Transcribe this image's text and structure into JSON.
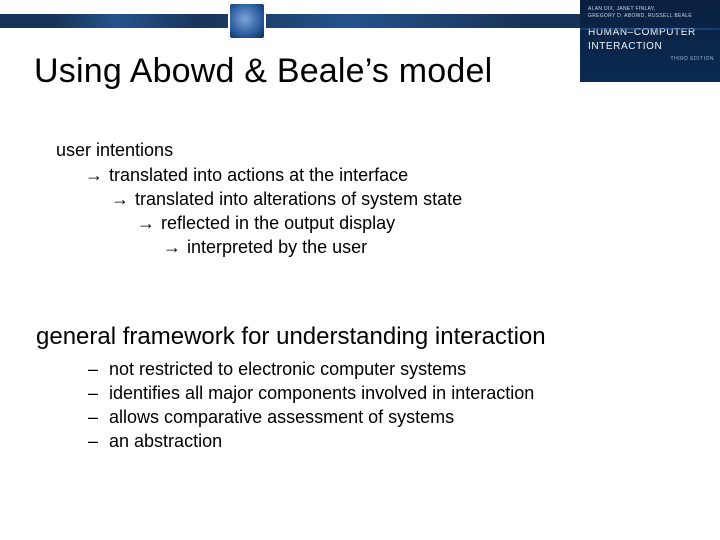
{
  "book": {
    "authors": "ALAN DIX, JANET FINLAY,\nGREGORY D. ABOWD, RUSSELL BEALE",
    "title": "HUMAN–COMPUTER\nINTERACTION",
    "edition": "THIRD EDITION"
  },
  "title": "Using Abowd & Beale’s model",
  "arrow": "→",
  "dash": "–",
  "section1": {
    "lead": "user intentions",
    "steps": [
      "translated into actions at the interface",
      "translated into alterations of system state",
      "reflected in the output display",
      "interpreted by the user"
    ]
  },
  "section2": {
    "lead": "general framework for understanding interaction",
    "items": [
      "not restricted to electronic computer systems",
      "identifies all major components involved in interaction",
      "allows comparative assessment of systems",
      "an abstraction"
    ]
  }
}
